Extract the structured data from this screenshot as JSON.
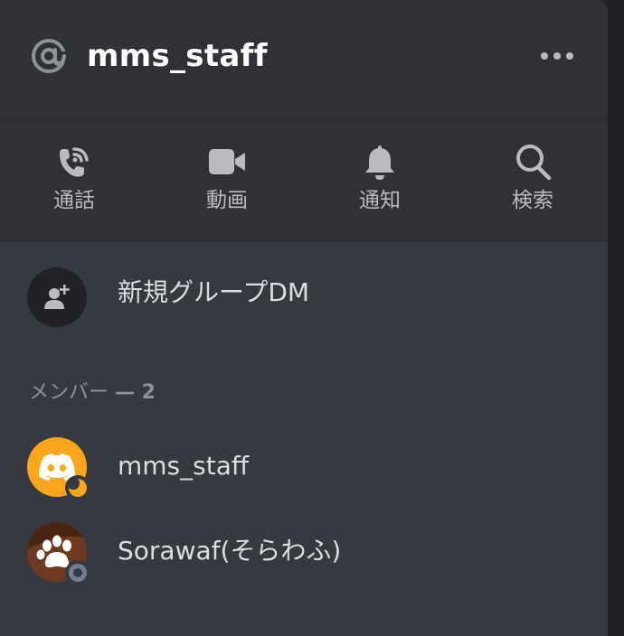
{
  "header": {
    "title": "mms_staff",
    "icon": "at-icon",
    "more_icon": "more-icon"
  },
  "actions": [
    {
      "label": "通話",
      "icon": "phone-icon"
    },
    {
      "label": "動画",
      "icon": "video-icon"
    },
    {
      "label": "通知",
      "icon": "bell-icon"
    },
    {
      "label": "検索",
      "icon": "search-icon"
    }
  ],
  "new_group": {
    "label": "新規グループDM",
    "icon": "add-user-icon"
  },
  "members": {
    "header_label": "メンバー",
    "header_count": "— 2",
    "list": [
      {
        "name": "mms_staff",
        "avatar": "discord-logo-avatar",
        "avatar_color": "#faa61a",
        "status": "idle"
      },
      {
        "name": "Sorawaf(そらわふ)",
        "avatar": "paw-avatar",
        "avatar_color": "#6b3a1f",
        "status": "offline"
      }
    ]
  },
  "colors": {
    "background": "#36393f",
    "header_background": "#2f3136",
    "text_primary": "#ffffff",
    "text_secondary": "#b9bbbe",
    "status_idle": "#faa61a",
    "status_offline": "#747f8d"
  }
}
